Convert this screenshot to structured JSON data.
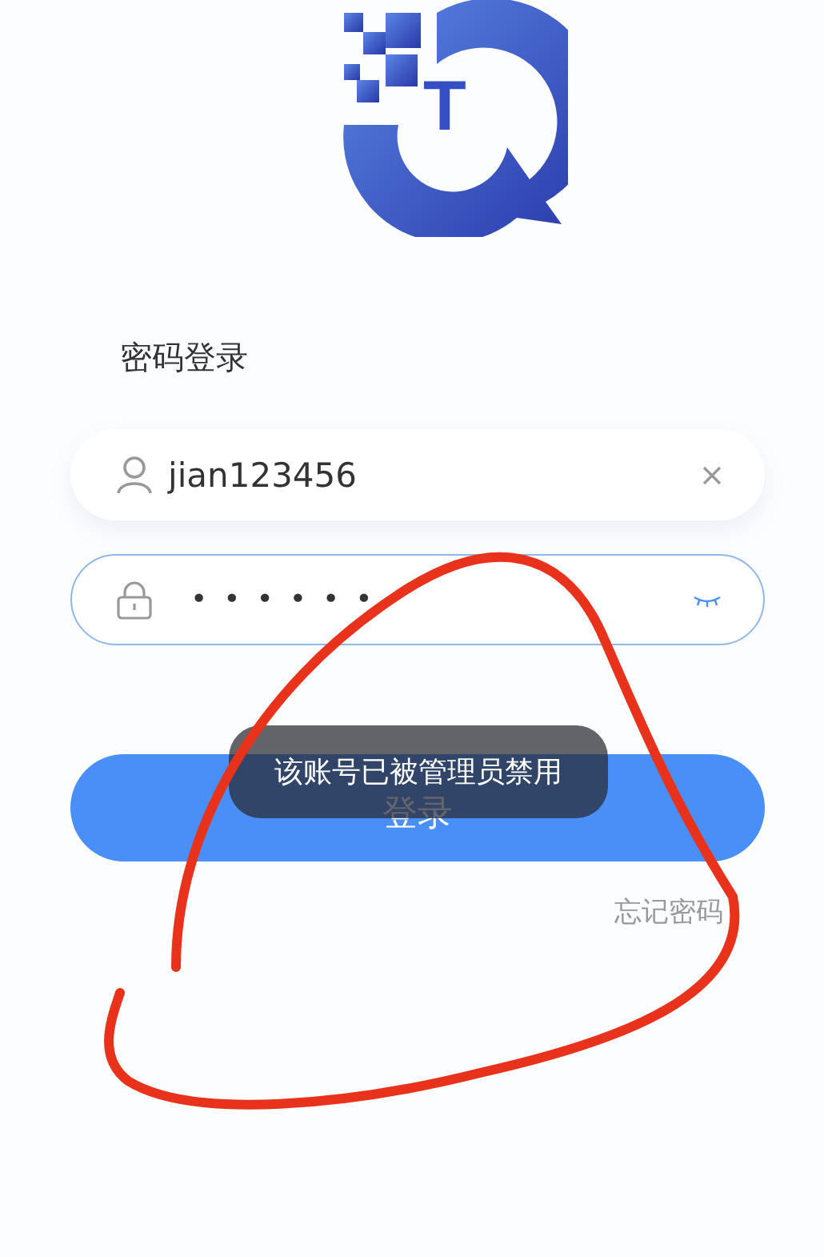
{
  "logo": {
    "letter": "T"
  },
  "title": "密码登录",
  "username_field": {
    "value": "jian123456"
  },
  "password_field": {
    "mask": "••••••",
    "focused": true
  },
  "login_button": {
    "label": "登录"
  },
  "toast": {
    "message": "该账号已被管理员禁用"
  },
  "forgot_password": "忘记密码"
}
